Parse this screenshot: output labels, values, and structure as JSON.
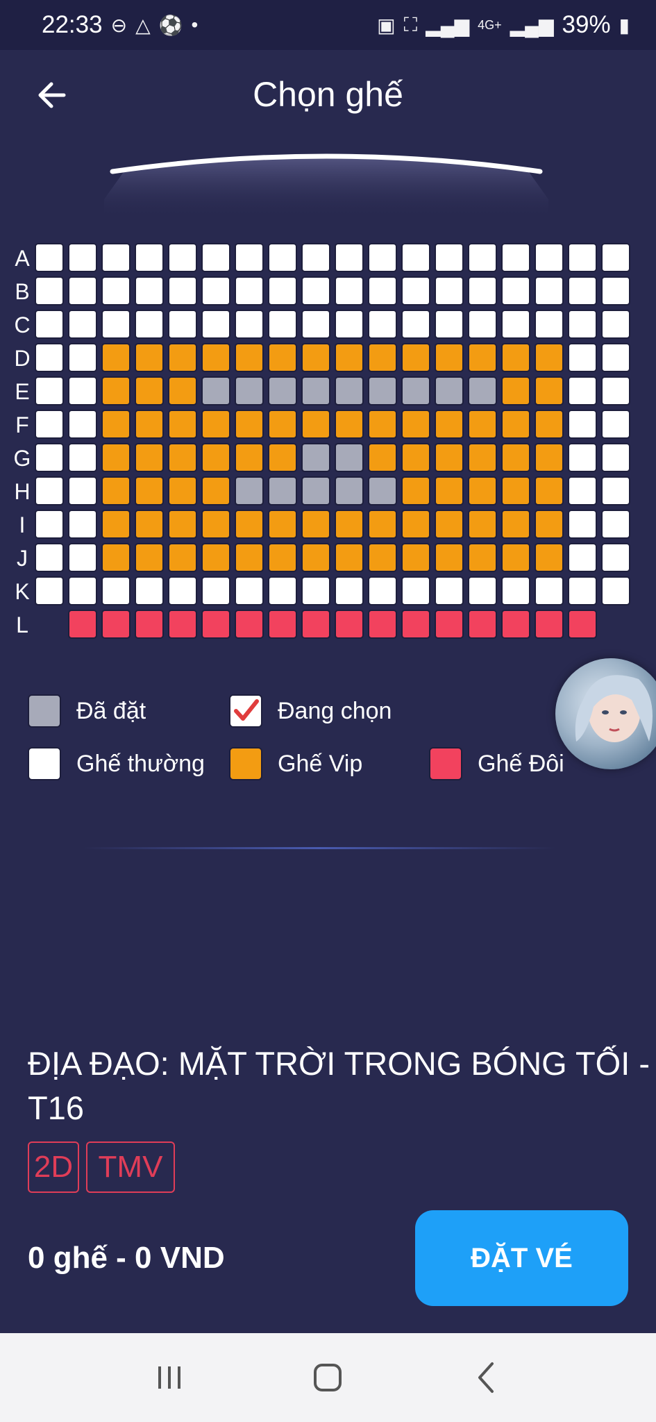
{
  "status_bar": {
    "time": "22:33",
    "battery": "39%",
    "network": "4G+",
    "icons": [
      "dnd-icon",
      "drive-icon",
      "soccer-icon",
      "dot-icon",
      "battery-saver-icon",
      "sleep-icon",
      "signal-icon",
      "4g-icon",
      "signal-icon",
      "battery-icon"
    ]
  },
  "header": {
    "title": "Chọn ghế",
    "back_icon": "arrow-left-icon"
  },
  "seat_map": {
    "rows": [
      {
        "label": "A",
        "seats": [
          "normal",
          "normal",
          "normal",
          "normal",
          "normal",
          "normal",
          "normal",
          "normal",
          "normal",
          "normal",
          "normal",
          "normal",
          "normal",
          "normal",
          "normal",
          "normal",
          "normal",
          "normal"
        ]
      },
      {
        "label": "B",
        "seats": [
          "normal",
          "normal",
          "normal",
          "normal",
          "normal",
          "normal",
          "normal",
          "normal",
          "normal",
          "normal",
          "normal",
          "normal",
          "normal",
          "normal",
          "normal",
          "normal",
          "normal",
          "normal"
        ]
      },
      {
        "label": "C",
        "seats": [
          "normal",
          "normal",
          "normal",
          "normal",
          "normal",
          "normal",
          "normal",
          "normal",
          "normal",
          "normal",
          "normal",
          "normal",
          "normal",
          "normal",
          "normal",
          "normal",
          "normal",
          "normal"
        ]
      },
      {
        "label": "D",
        "seats": [
          "normal",
          "normal",
          "vip",
          "vip",
          "vip",
          "vip",
          "vip",
          "vip",
          "vip",
          "vip",
          "vip",
          "vip",
          "vip",
          "vip",
          "vip",
          "vip",
          "normal",
          "normal"
        ]
      },
      {
        "label": "E",
        "seats": [
          "normal",
          "normal",
          "vip",
          "vip",
          "vip",
          "booked",
          "booked",
          "booked",
          "booked",
          "booked",
          "booked",
          "booked",
          "booked",
          "booked",
          "vip",
          "vip",
          "normal",
          "normal"
        ]
      },
      {
        "label": "F",
        "seats": [
          "normal",
          "normal",
          "vip",
          "vip",
          "vip",
          "vip",
          "vip",
          "vip",
          "vip",
          "vip",
          "vip",
          "vip",
          "vip",
          "vip",
          "vip",
          "vip",
          "normal",
          "normal"
        ]
      },
      {
        "label": "G",
        "seats": [
          "normal",
          "normal",
          "vip",
          "vip",
          "vip",
          "vip",
          "vip",
          "vip",
          "booked",
          "booked",
          "vip",
          "vip",
          "vip",
          "vip",
          "vip",
          "vip",
          "normal",
          "normal"
        ]
      },
      {
        "label": "H",
        "seats": [
          "normal",
          "normal",
          "vip",
          "vip",
          "vip",
          "vip",
          "booked",
          "booked",
          "booked",
          "booked",
          "booked",
          "vip",
          "vip",
          "vip",
          "vip",
          "vip",
          "normal",
          "normal"
        ]
      },
      {
        "label": "I",
        "seats": [
          "normal",
          "normal",
          "vip",
          "vip",
          "vip",
          "vip",
          "vip",
          "vip",
          "vip",
          "vip",
          "vip",
          "vip",
          "vip",
          "vip",
          "vip",
          "vip",
          "normal",
          "normal"
        ]
      },
      {
        "label": "J",
        "seats": [
          "normal",
          "normal",
          "vip",
          "vip",
          "vip",
          "vip",
          "vip",
          "vip",
          "vip",
          "vip",
          "vip",
          "vip",
          "vip",
          "vip",
          "vip",
          "vip",
          "normal",
          "normal"
        ]
      },
      {
        "label": "K",
        "seats": [
          "normal",
          "normal",
          "normal",
          "normal",
          "normal",
          "normal",
          "normal",
          "normal",
          "normal",
          "normal",
          "normal",
          "normal",
          "normal",
          "normal",
          "normal",
          "normal",
          "normal",
          "normal"
        ]
      },
      {
        "label": "L",
        "seats": [
          "double",
          "double",
          "double",
          "double",
          "double",
          "double",
          "double",
          "double",
          "double",
          "double",
          "double",
          "double",
          "double",
          "double",
          "double",
          "double"
        ]
      }
    ]
  },
  "legend": {
    "booked": "Đã đặt",
    "selecting": "Đang chọn",
    "normal": "Ghế thường",
    "vip": "Ghế Vip",
    "double": "Ghế Đôi"
  },
  "colors": {
    "background": "#28294f",
    "normal": "#ffffff",
    "vip": "#f39c12",
    "booked": "#a7aab9",
    "double": "#f2425e",
    "check": "#e03d3d",
    "book_button": "#1ea0f8",
    "tag_border": "#e03d58"
  },
  "movie": {
    "title": "ĐỊA ĐẠO: MẶT TRỜI TRONG BÓNG TỐI - T16",
    "tags": [
      "2D",
      "TMV"
    ]
  },
  "summary": {
    "text": "0 ghế - 0 VND"
  },
  "actions": {
    "book_label": "ĐẶT VÉ"
  },
  "nav_bar": {
    "icons": [
      "recent-apps-icon",
      "home-icon",
      "back-icon"
    ]
  }
}
